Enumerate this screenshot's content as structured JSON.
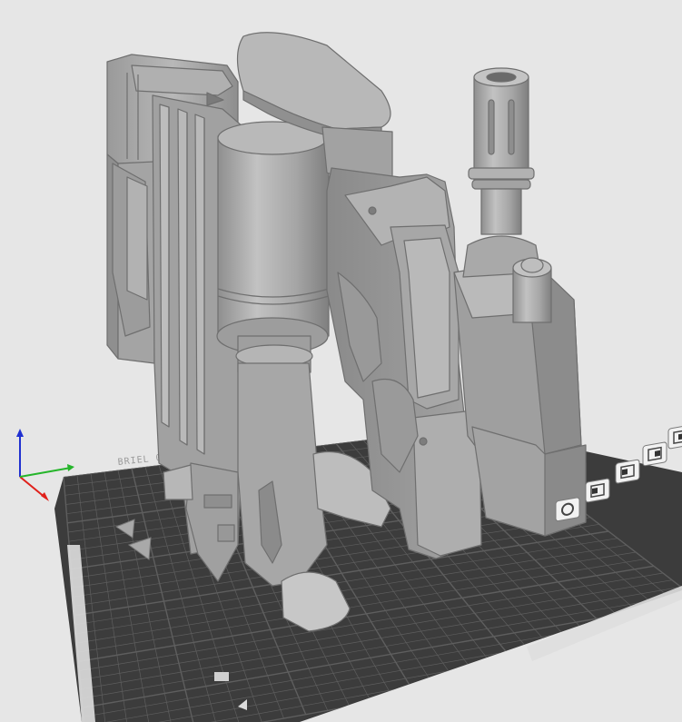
{
  "viewport": {
    "background": "#e6e6e6",
    "bed": {
      "color": "#3c3c3c",
      "grid_color": "#5e5e5e",
      "label": "BRIEL 0"
    },
    "model": {
      "name": "",
      "color": "#a9a9a9",
      "shade": "#8c8c8c",
      "highlight": "#c4c4c4"
    },
    "axes": {
      "x_color": "#e0201a",
      "y_color": "#25b52a",
      "z_color": "#2030d0"
    },
    "view_buttons": [
      {
        "icon": "view-3d-icon"
      },
      {
        "icon": "view-front-icon"
      },
      {
        "icon": "view-top-icon"
      },
      {
        "icon": "view-left-icon"
      },
      {
        "icon": "view-right-icon"
      }
    ]
  }
}
